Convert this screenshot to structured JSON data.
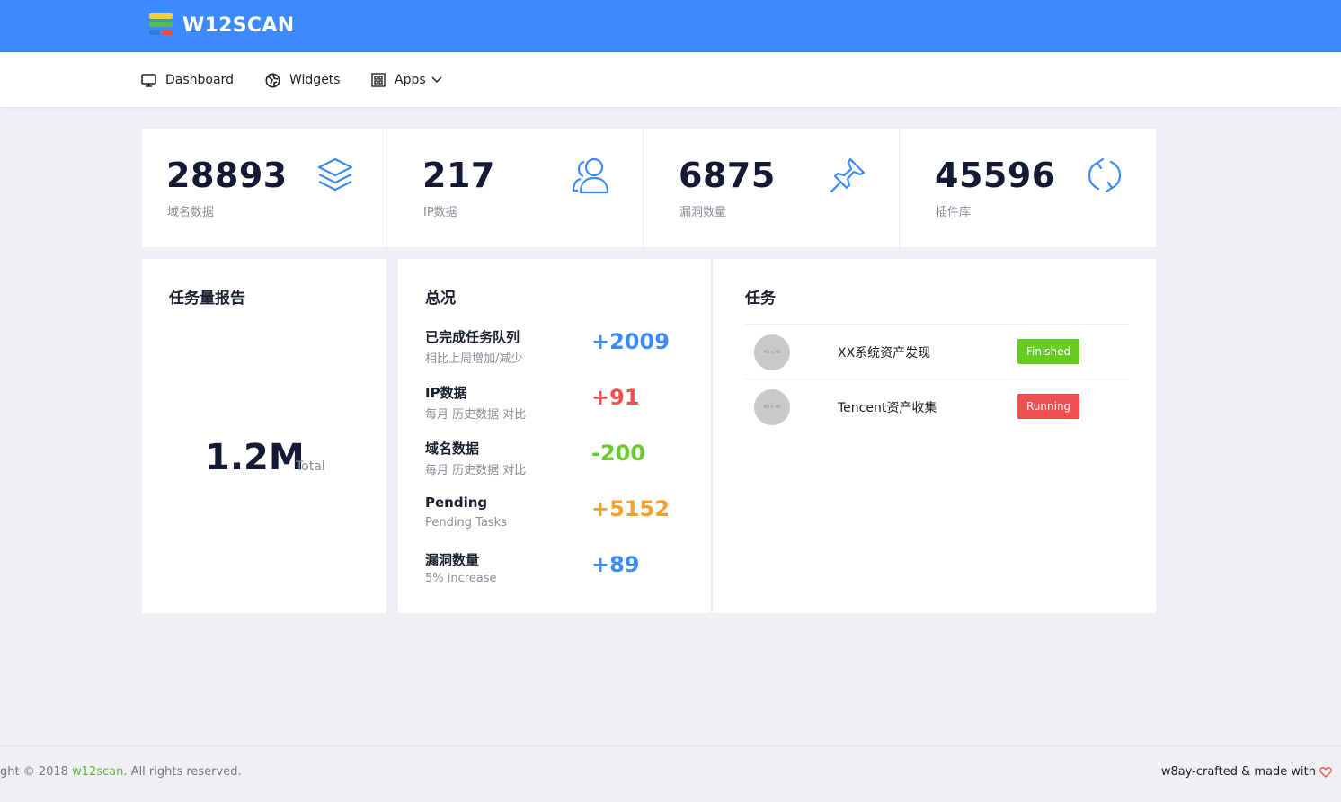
{
  "brand": {
    "name": "W12SCAN",
    "logo_colors": [
      "#f5d033",
      "#5cb85c",
      "#2f7bd8",
      "#e74c3c"
    ],
    "topbar_color": "#3d8aff"
  },
  "nav": {
    "items": [
      {
        "label": "Dashboard",
        "icon": "monitor-icon"
      },
      {
        "label": "Widgets",
        "icon": "globe-icon"
      },
      {
        "label": "Apps",
        "icon": "apps-grid-icon"
      }
    ]
  },
  "stats": [
    {
      "value": "28893",
      "label": "域名数据",
      "icon": "layers-icon"
    },
    {
      "value": "217",
      "label": "IP数据",
      "icon": "users-icon"
    },
    {
      "value": "6875",
      "label": "漏洞数量",
      "icon": "pin-icon"
    },
    {
      "value": "45596",
      "label": "插件库",
      "icon": "refresh-icon"
    }
  ],
  "report": {
    "title": "任务量报告",
    "total_value": "1.2M",
    "total_label": "Total"
  },
  "overview": {
    "title": "总况",
    "rows": [
      {
        "title": "已完成任务队列",
        "subtitle": "相比上周增加/减少",
        "value": "+2009",
        "color": "#3d8aff"
      },
      {
        "title": "IP数据",
        "subtitle": "每月 历史数据 对比",
        "value": "+91",
        "color": "#f04f4f"
      },
      {
        "title": "域名数据",
        "subtitle": "每月 历史数据 对比",
        "value": "-200",
        "color": "#6ac92f"
      },
      {
        "title": "Pending",
        "subtitle": "Pending Tasks",
        "value": "+5152",
        "color": "#f5a02a"
      },
      {
        "title": "漏洞数量",
        "subtitle": "5% increase",
        "value": "+89",
        "color": "#3d8aff"
      }
    ]
  },
  "tasks": {
    "title": "任务",
    "rows": [
      {
        "avatar": "40 x 40",
        "name": "XX系统资产发现",
        "status": "Finished",
        "status_color": "#66cc24"
      },
      {
        "avatar": "40 x 40",
        "name": "Tencent资产收集",
        "status": "Running",
        "status_color": "#f04f4f"
      }
    ]
  },
  "footer": {
    "left_prefix": "ght © 2018 ",
    "left_link": "w12scan",
    "left_suffix": ". All rights reserved.",
    "right_text": "w8ay-crafted & made with",
    "heart_icon": "heart-icon"
  }
}
